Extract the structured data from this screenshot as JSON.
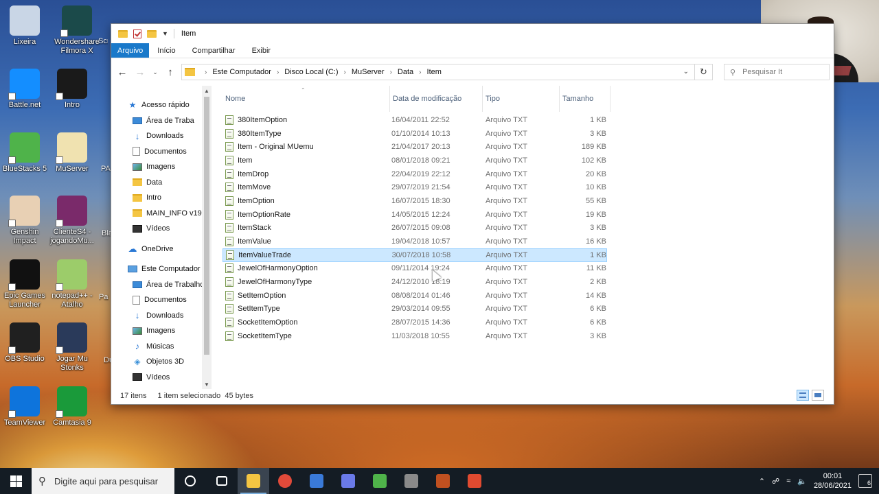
{
  "desktop": {
    "icons": [
      {
        "label": "Lixeira",
        "color": "#c9d6e6"
      },
      {
        "label": "Wondershare Filmora X",
        "color": "#1b4a4a"
      },
      {
        "label": "Battle.net",
        "color": "#148eff"
      },
      {
        "label": "Intro",
        "color": "#1a1a1a"
      },
      {
        "label": "BlueStacks 5",
        "color": "#4fb34a"
      },
      {
        "label": "MuServer",
        "color": "#f0e2b0"
      },
      {
        "label": "Genshin Impact",
        "color": "#e8d0b4"
      },
      {
        "label": "ClienteS4 - jogandoMu...",
        "color": "#7a2a6a"
      },
      {
        "label": "Epic Games Launcher",
        "color": "#111111"
      },
      {
        "label": "notepad++ - Atalho",
        "color": "#9ccc6a"
      },
      {
        "label": "OBS Studio",
        "color": "#202020"
      },
      {
        "label": "Jogar Mu Stonks",
        "color": "#2a3a5a"
      },
      {
        "label": "TeamViewer",
        "color": "#0e74dc"
      },
      {
        "label": "Camtasia 9",
        "color": "#1a9a3a"
      }
    ],
    "partials": [
      "Scre",
      "PA",
      "Bla PO",
      "Pai",
      "Du"
    ]
  },
  "window": {
    "title": "Item",
    "tabs": [
      "Arquivo",
      "Início",
      "Compartilhar",
      "Exibir"
    ],
    "breadcrumb": [
      "Este Computador",
      "Disco Local (C:)",
      "MuServer",
      "Data",
      "Item"
    ],
    "search_placeholder": "Pesquisar It",
    "nav": [
      {
        "label": "Acesso rápido",
        "icon": "star-icon",
        "level": 0,
        "pinned": false
      },
      {
        "label": "Área de Traba",
        "icon": "desktop-icon",
        "level": 1,
        "pinned": true
      },
      {
        "label": "Downloads",
        "icon": "download-icon",
        "level": 1,
        "pinned": true
      },
      {
        "label": "Documentos",
        "icon": "document-icon",
        "level": 1,
        "pinned": true
      },
      {
        "label": "Imagens",
        "icon": "image-icon",
        "level": 1,
        "pinned": true
      },
      {
        "label": "Data",
        "icon": "folder-icon",
        "level": 1,
        "pinned": false
      },
      {
        "label": "Intro",
        "icon": "folder-icon",
        "level": 1,
        "pinned": false
      },
      {
        "label": "MAIN_INFO v19",
        "icon": "folder-icon",
        "level": 1,
        "pinned": false
      },
      {
        "label": "Vídeos",
        "icon": "video-icon",
        "level": 1,
        "pinned": false
      },
      {
        "label": "OneDrive",
        "icon": "cloud-icon",
        "level": 0,
        "pinned": false
      },
      {
        "label": "Este Computador",
        "icon": "computer-icon",
        "level": 0,
        "pinned": false
      },
      {
        "label": "Área de Trabalho",
        "icon": "desktop-icon",
        "level": 1,
        "pinned": false
      },
      {
        "label": "Documentos",
        "icon": "document-icon",
        "level": 1,
        "pinned": false
      },
      {
        "label": "Downloads",
        "icon": "download-icon",
        "level": 1,
        "pinned": false
      },
      {
        "label": "Imagens",
        "icon": "image-icon",
        "level": 1,
        "pinned": false
      },
      {
        "label": "Músicas",
        "icon": "music-icon",
        "level": 1,
        "pinned": false
      },
      {
        "label": "Objetos 3D",
        "icon": "cube-icon",
        "level": 1,
        "pinned": false
      },
      {
        "label": "Vídeos",
        "icon": "video-icon",
        "level": 1,
        "pinned": false
      }
    ],
    "columns": [
      "Nome",
      "Data de modificação",
      "Tipo",
      "Tamanho"
    ],
    "files": [
      {
        "name": "380ItemOption",
        "date": "16/04/2011 22:52",
        "type": "Arquivo TXT",
        "size": "1 KB"
      },
      {
        "name": "380ItemType",
        "date": "01/10/2014 10:13",
        "type": "Arquivo TXT",
        "size": "3 KB"
      },
      {
        "name": "Item - Original MUemu",
        "date": "21/04/2017 20:13",
        "type": "Arquivo TXT",
        "size": "189 KB"
      },
      {
        "name": "Item",
        "date": "08/01/2018 09:21",
        "type": "Arquivo TXT",
        "size": "102 KB"
      },
      {
        "name": "ItemDrop",
        "date": "22/04/2019 22:12",
        "type": "Arquivo TXT",
        "size": "20 KB"
      },
      {
        "name": "ItemMove",
        "date": "29/07/2019 21:54",
        "type": "Arquivo TXT",
        "size": "10 KB"
      },
      {
        "name": "ItemOption",
        "date": "16/07/2015 18:30",
        "type": "Arquivo TXT",
        "size": "55 KB"
      },
      {
        "name": "ItemOptionRate",
        "date": "14/05/2015 12:24",
        "type": "Arquivo TXT",
        "size": "19 KB"
      },
      {
        "name": "ItemStack",
        "date": "26/07/2015 09:08",
        "type": "Arquivo TXT",
        "size": "3 KB"
      },
      {
        "name": "ItemValue",
        "date": "19/04/2018 10:57",
        "type": "Arquivo TXT",
        "size": "16 KB"
      },
      {
        "name": "ItemValueTrade",
        "date": "30/07/2018 10:58",
        "type": "Arquivo TXT",
        "size": "1 KB",
        "selected": true
      },
      {
        "name": "JewelOfHarmonyOption",
        "date": "09/11/2014 19:24",
        "type": "Arquivo TXT",
        "size": "11 KB"
      },
      {
        "name": "JewelOfHarmonyType",
        "date": "24/12/2010 18:19",
        "type": "Arquivo TXT",
        "size": "2 KB"
      },
      {
        "name": "SetItemOption",
        "date": "08/08/2014 01:46",
        "type": "Arquivo TXT",
        "size": "14 KB"
      },
      {
        "name": "SetItemType",
        "date": "29/03/2014 09:55",
        "type": "Arquivo TXT",
        "size": "6 KB"
      },
      {
        "name": "SocketItemOption",
        "date": "28/07/2015 14:36",
        "type": "Arquivo TXT",
        "size": "6 KB"
      },
      {
        "name": "SocketItemType",
        "date": "11/03/2018 10:55",
        "type": "Arquivo TXT",
        "size": "3 KB"
      }
    ],
    "status": {
      "count": "17 itens",
      "selection": "1 item selecionado  45 bytes"
    }
  },
  "taskbar": {
    "search_placeholder": "Digite aqui para pesquisar",
    "apps": [
      {
        "name": "task-view",
        "color": "#ffffff"
      },
      {
        "name": "file-explorer",
        "color": "#f4c542",
        "active": true
      },
      {
        "name": "chrome",
        "color": "#e04a3a"
      },
      {
        "name": "network-app",
        "color": "#3a7ad8"
      },
      {
        "name": "discord",
        "color": "#6a7ae8"
      },
      {
        "name": "android-app",
        "color": "#4fb34a"
      },
      {
        "name": "box-app",
        "color": "#8a8a8a"
      },
      {
        "name": "game-app",
        "color": "#c05020"
      },
      {
        "name": "camtasia",
        "color": "#e04a30"
      }
    ],
    "time": "00:01",
    "date": "28/06/2021",
    "notifications": "6"
  }
}
